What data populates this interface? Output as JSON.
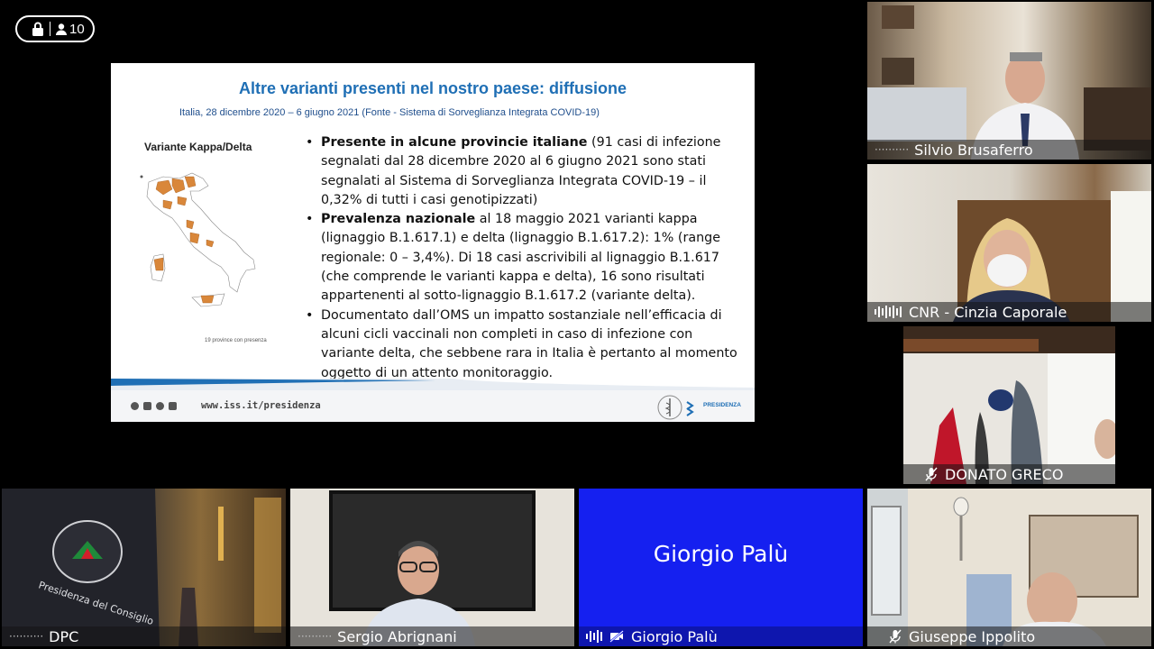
{
  "header": {
    "participant_count": "10",
    "lock_icon": "lock-icon",
    "people_icon": "person-icon"
  },
  "slide": {
    "title": "Altre varianti presenti nel nostro paese: diffusione",
    "subtitle": "Italia, 28 dicembre 2020 – 6 giugno 2021 (Fonte - Sistema di Sorveglianza Integrata COVID-19)",
    "map_label": "Variante Kappa/Delta",
    "map_caption": "19 province con presenza",
    "bullets": [
      {
        "bold": "Presente in alcune provincie italiane",
        "text": " (91 casi di infezione segnalati dal 28 dicembre 2020 al 6 giugno 2021 sono stati segnalati al Sistema di Sorveglianza Integrata COVID-19 – il 0,32% di tutti i casi genotipizzati)"
      },
      {
        "bold": "Prevalenza nazionale",
        "text": " al 18 maggio 2021 varianti kappa (lignaggio B.1.617.1) e delta (lignaggio B.1.617.2): 1% (range regionale: 0 – 3,4%). Di 18 casi ascrivibili al lignaggio B.1.617 (che comprende le varianti kappa e delta), 16 sono risultati appartenenti al sotto-lignaggio B.1.617.2 (variante delta)."
      },
      {
        "bold": "",
        "text": "Documentato dall’OMS un impatto sostanziale nell’efficacia di alcuni cicli vaccinali non completi in caso di infezione con variante delta, che sebbene rara in Italia è pertanto al momento oggetto di un attento monitoraggio."
      }
    ],
    "footer_url": "www.iss.it/presidenza",
    "footer_brand": "PRESIDENZA",
    "accent_color": "#1f6fb5",
    "map_highlight_color": "#d9873a"
  },
  "participants": {
    "silvio": {
      "name": "Silvio Brusaferro",
      "status": "speaking-idle"
    },
    "cinzia": {
      "name": "CNR - Cinzia Caporale",
      "status": "speaking"
    },
    "donato": {
      "name": "DONATO GRECO",
      "status": "muted"
    },
    "dpc": {
      "name": "DPC",
      "status": "idle"
    },
    "sergio": {
      "name": "Sergio Abrignani",
      "status": "idle"
    },
    "giorgio": {
      "name": "Giorgio Palù",
      "display_name": "Giorgio Palù",
      "status": "muted-audio",
      "tile_color": "#1520f0"
    },
    "giuseppe": {
      "name": "Giuseppe Ippolito",
      "status": "muted"
    }
  }
}
